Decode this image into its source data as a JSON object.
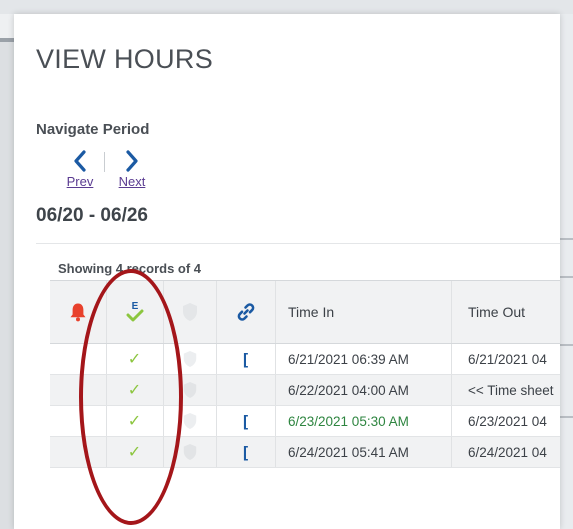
{
  "page": {
    "title": "VIEW HOURS"
  },
  "nav": {
    "label": "Navigate Period",
    "prev_label": "Prev",
    "next_label": "Next",
    "period": "06/20 - 06/26"
  },
  "records": {
    "summary": "Showing 4 records of 4"
  },
  "table": {
    "headers": {
      "alert_icon": "bell-icon",
      "employee_icon": "employee-check-icon",
      "shield_icon": "shield-icon",
      "link_icon": "link-icon",
      "time_in": "Time In",
      "time_out": "Time Out"
    },
    "rows": [
      {
        "approved_icon": "check-icon",
        "entry_icon": "bracket-icon",
        "time_in": "6/21/2021 06:39 AM",
        "time_out": "6/21/2021 04"
      },
      {
        "approved_icon": "check-icon",
        "entry_icon": "",
        "time_in": "6/22/2021 04:00 AM",
        "time_out": "<< Time sheet"
      },
      {
        "approved_icon": "check-icon",
        "entry_icon": "bracket-icon",
        "time_in": "6/23/2021 05:30 AM",
        "time_out": "6/23/2021 04"
      },
      {
        "approved_icon": "check-icon",
        "entry_icon": "bracket-icon",
        "time_in": "6/24/2021 05:41 AM",
        "time_out": "6/24/2021 04"
      }
    ]
  },
  "colors": {
    "accent_blue": "#1b5aa3",
    "check_green": "#8cc63f",
    "alert_red": "#e8412c",
    "time_green": "#2e8540",
    "annotation_red": "#a4161a",
    "link_purple": "#5a3b91"
  }
}
